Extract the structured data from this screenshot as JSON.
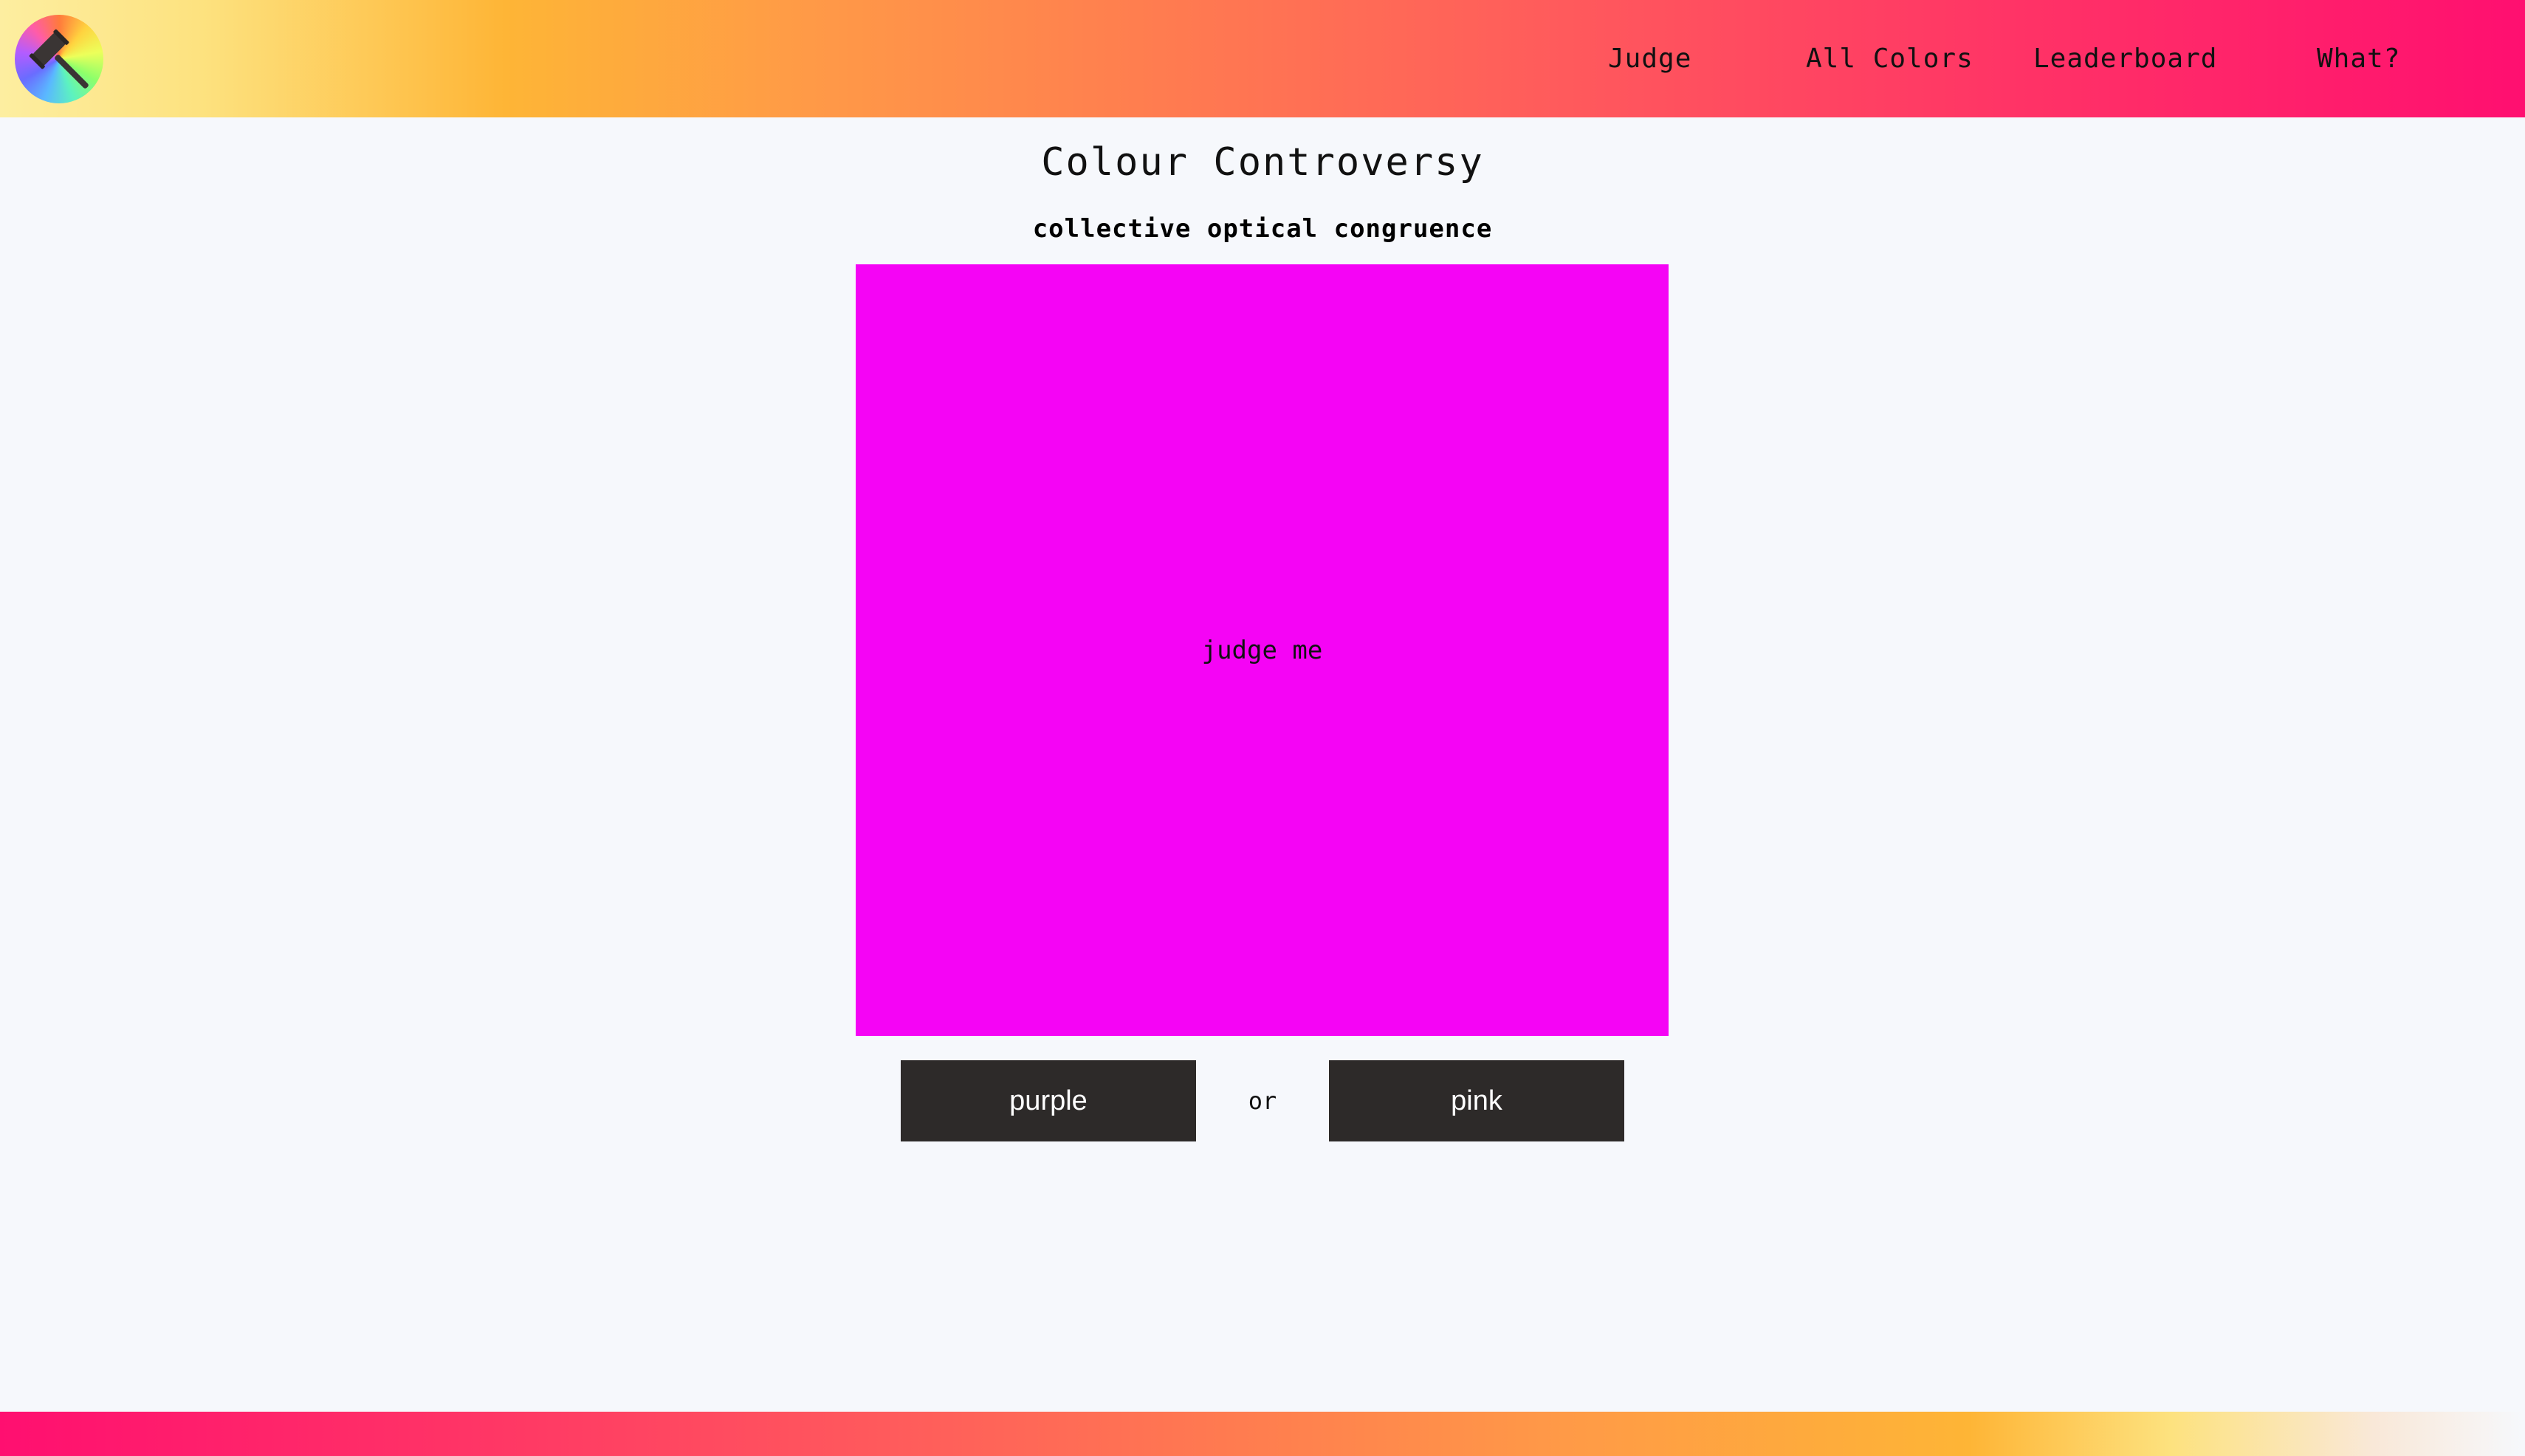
{
  "header": {
    "logo_icon": "gavel-color-wheel-icon",
    "nav": {
      "judge": "Judge",
      "all_colors": "All Colors",
      "leaderboard": "Leaderboard",
      "what": "What?"
    }
  },
  "main": {
    "title": "Colour Controversy",
    "subtitle": "collective optical congruence",
    "swatch": {
      "label": "judge me",
      "color": "#f504f5"
    },
    "choices": {
      "left": "purple",
      "separator": "or",
      "right": "pink"
    }
  },
  "colors": {
    "button_bg": "#2d2a29",
    "page_bg": "#f6f8fc"
  }
}
